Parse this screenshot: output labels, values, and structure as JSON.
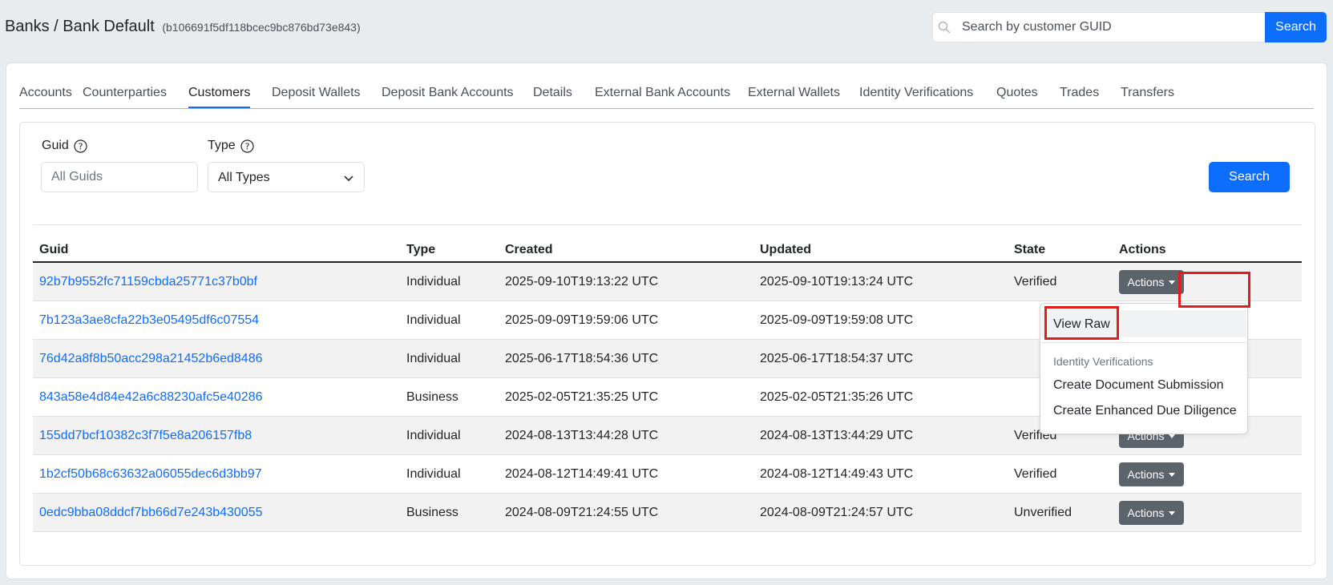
{
  "header": {
    "title": "Banks / Bank Default",
    "bank_id": "(b106691f5df118bcec9bc876bd73e843)",
    "search": {
      "placeholder": "Search by customer GUID",
      "value": "",
      "button_label": "Search"
    }
  },
  "tabs": [
    {
      "label": "Accounts",
      "active": false
    },
    {
      "label": "Counterparties",
      "active": false
    },
    {
      "label": "Customers",
      "active": true
    },
    {
      "label": "Deposit Wallets",
      "active": false
    },
    {
      "label": "Deposit Bank Accounts",
      "active": false
    },
    {
      "label": "Details",
      "active": false
    },
    {
      "label": "External Bank Accounts",
      "active": false
    },
    {
      "label": "External Wallets",
      "active": false
    },
    {
      "label": "Identity Verifications",
      "active": false
    },
    {
      "label": "Quotes",
      "active": false
    },
    {
      "label": "Trades",
      "active": false
    },
    {
      "label": "Transfers",
      "active": false
    }
  ],
  "filters": {
    "guid": {
      "label": "Guid",
      "placeholder": "All Guids",
      "value": ""
    },
    "type": {
      "label": "Type",
      "selected": "All Types"
    },
    "search_button": "Search"
  },
  "table": {
    "columns": [
      "Guid",
      "Type",
      "Created",
      "Updated",
      "State",
      "Actions"
    ],
    "rows": [
      {
        "guid": "92b7b9552fc71159cbda25771c37b0bf",
        "type": "Individual",
        "created": "2025-09-10T19:13:22 UTC",
        "updated": "2025-09-10T19:13:24 UTC",
        "state": "Verified",
        "action": "Actions"
      },
      {
        "guid": "7b123a3ae8cfa22b3e05495df6c07554",
        "type": "Individual",
        "created": "2025-09-09T19:59:06 UTC",
        "updated": "2025-09-09T19:59:08 UTC",
        "state": "",
        "action": ""
      },
      {
        "guid": "76d42a8f8b50acc298a21452b6ed8486",
        "type": "Individual",
        "created": "2025-06-17T18:54:36 UTC",
        "updated": "2025-06-17T18:54:37 UTC",
        "state": "",
        "action": ""
      },
      {
        "guid": "843a58e4d84e42a6c88230afc5e40286",
        "type": "Business",
        "created": "2025-02-05T21:35:25 UTC",
        "updated": "2025-02-05T21:35:26 UTC",
        "state": "",
        "action": ""
      },
      {
        "guid": "155dd7bcf10382c3f7f5e8a206157fb8",
        "type": "Individual",
        "created": "2024-08-13T13:44:28 UTC",
        "updated": "2024-08-13T13:44:29 UTC",
        "state": "Verified",
        "action": "Actions"
      },
      {
        "guid": "1b2cf50b68c63632a06055dec6d3bb97",
        "type": "Individual",
        "created": "2024-08-12T14:49:41 UTC",
        "updated": "2024-08-12T14:49:43 UTC",
        "state": "Verified",
        "action": "Actions"
      },
      {
        "guid": "0edc9bba08ddcf7bb66d7e243b430055",
        "type": "Business",
        "created": "2024-08-09T21:24:55 UTC",
        "updated": "2024-08-09T21:24:57 UTC",
        "state": "Unverified",
        "action": "Actions"
      }
    ]
  },
  "dropdown": {
    "view_raw": "View Raw",
    "section_header": "Identity Verifications",
    "items": [
      "Create Document Submission",
      "Create Enhanced Due Diligence"
    ]
  },
  "colors": {
    "primary": "#0d6efd",
    "secondary_button": "#5c636a",
    "highlight": "#e31b1b",
    "page_bg": "#e9ecef"
  }
}
